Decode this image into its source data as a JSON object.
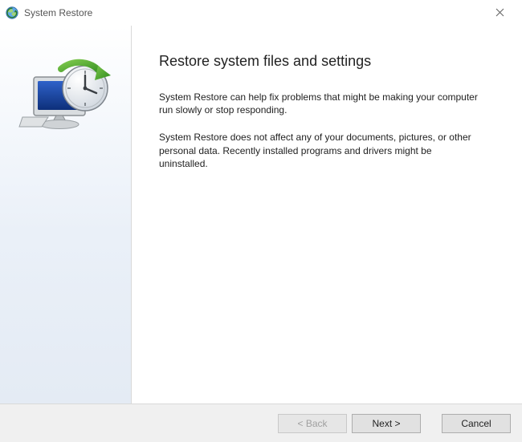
{
  "window": {
    "title": "System Restore"
  },
  "content": {
    "heading": "Restore system files and settings",
    "paragraph1": "System Restore can help fix problems that might be making your computer run slowly or stop responding.",
    "paragraph2": "System Restore does not affect any of your documents, pictures, or other personal data. Recently installed programs and drivers might be uninstalled."
  },
  "buttons": {
    "back": "< Back",
    "next": "Next >",
    "cancel": "Cancel",
    "back_enabled": false
  }
}
